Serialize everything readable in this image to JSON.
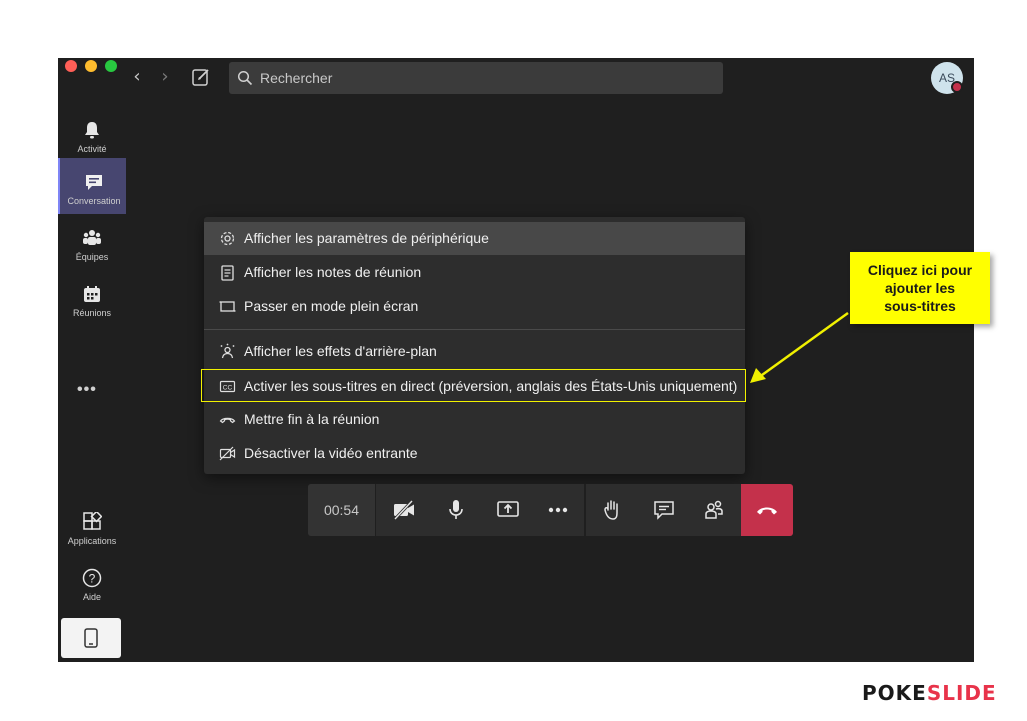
{
  "search": {
    "placeholder": "Rechercher"
  },
  "user": {
    "initials": "AS"
  },
  "sidebar": {
    "items": [
      {
        "label": "Activité",
        "icon": "bell-icon"
      },
      {
        "label": "Conversation",
        "icon": "chat-icon",
        "active": true
      },
      {
        "label": "Équipes",
        "icon": "teams-icon"
      },
      {
        "label": "Réunions",
        "icon": "calendar-icon"
      },
      {
        "label": "Applications",
        "icon": "apps-icon"
      },
      {
        "label": "Aide",
        "icon": "help-icon"
      }
    ],
    "more": "•••"
  },
  "menu": {
    "items": [
      {
        "label": "Afficher les paramètres de périphérique",
        "icon": "gear-icon"
      },
      {
        "label": "Afficher les notes de réunion",
        "icon": "notes-icon"
      },
      {
        "label": "Passer en mode plein écran",
        "icon": "fullscreen-icon"
      },
      {
        "label": "Afficher les effets d'arrière-plan",
        "icon": "background-effects-icon"
      },
      {
        "label": "Activer les sous-titres en direct (préversion, anglais des États-Unis uniquement)",
        "icon": "closed-captions-icon"
      },
      {
        "label": "Mettre fin à la réunion",
        "icon": "end-call-icon"
      },
      {
        "label": "Désactiver la vidéo entrante",
        "icon": "video-off-icon"
      }
    ]
  },
  "call": {
    "timer": "00:54"
  },
  "callout": {
    "line1": "Cliquez ici pour",
    "line2": "ajouter les",
    "line3": "sous-titres"
  },
  "brand": {
    "part1": "POKE",
    "part2": "SLIDE"
  },
  "colors": {
    "accent": "#474670",
    "hangup": "#c4314b",
    "callout": "#ffff00",
    "highlight": "#f2f200"
  }
}
